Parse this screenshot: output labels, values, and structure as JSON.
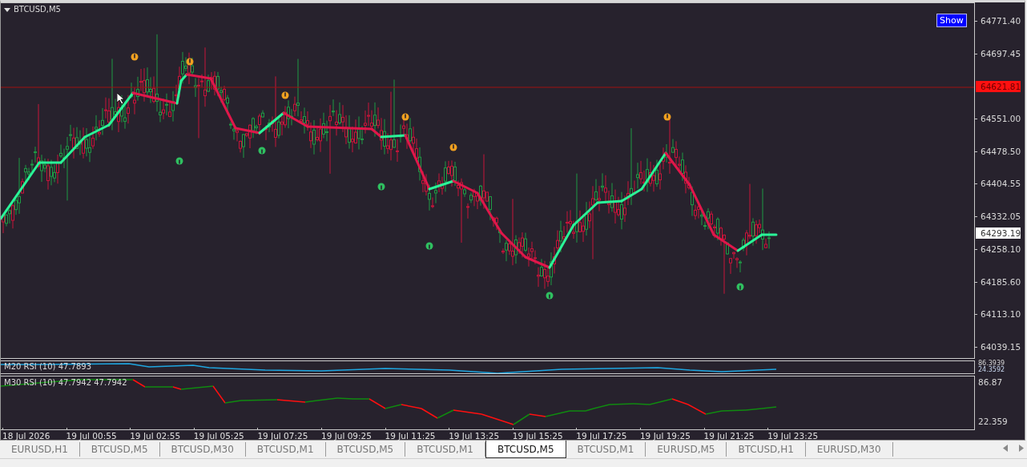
{
  "chart": {
    "title": "BTCUSD,M5",
    "show_button": "Show",
    "price_axis": [
      "64771.40",
      "64697.45",
      "64551.00",
      "64478.50",
      "64404.55",
      "64332.05",
      "64258.10",
      "64185.60",
      "64113.10",
      "64039.15"
    ],
    "price_markers": [
      {
        "kind": "bid_line",
        "label": "64621.81"
      },
      {
        "kind": "last",
        "label": "64293.19"
      }
    ]
  },
  "indicators": [
    {
      "kind": "single",
      "label": "M20 RSI (10) 47.7893",
      "scale": [
        "86.3939",
        "24.3592"
      ]
    },
    {
      "kind": "dual",
      "label": "M30 RSI (10) 47.7942 47.7942",
      "scale": [
        "86.87",
        "22.359"
      ]
    }
  ],
  "time_axis": [
    "18 Jul 2026",
    "19 Jul 00:55",
    "19 Jul 02:55",
    "19 Jul 05:25",
    "19 Jul 07:25",
    "19 Jul 09:25",
    "19 Jul 11:25",
    "19 Jul 13:25",
    "19 Jul 15:25",
    "19 Jul 17:25",
    "19 Jul 19:25",
    "19 Jul 21:25",
    "19 Jul 23:25"
  ],
  "tabs": [
    {
      "label": "EURUSD,H1",
      "selected": false
    },
    {
      "label": "BTCUSD,M5",
      "selected": false
    },
    {
      "label": "BTCUSD,M30",
      "selected": false
    },
    {
      "label": "BTCUSD,M1",
      "selected": false
    },
    {
      "label": "BTCUSD,M5",
      "selected": false
    },
    {
      "label": "BTCUSD,M1",
      "selected": false
    },
    {
      "label": "BTCUSD,M5",
      "selected": true
    },
    {
      "label": "BTCUSD,M1",
      "selected": false
    },
    {
      "label": "EURUSD,M5",
      "selected": false
    },
    {
      "label": "BTCUSD,H1",
      "selected": false
    },
    {
      "label": "EURUSD,M30",
      "selected": false
    }
  ]
}
